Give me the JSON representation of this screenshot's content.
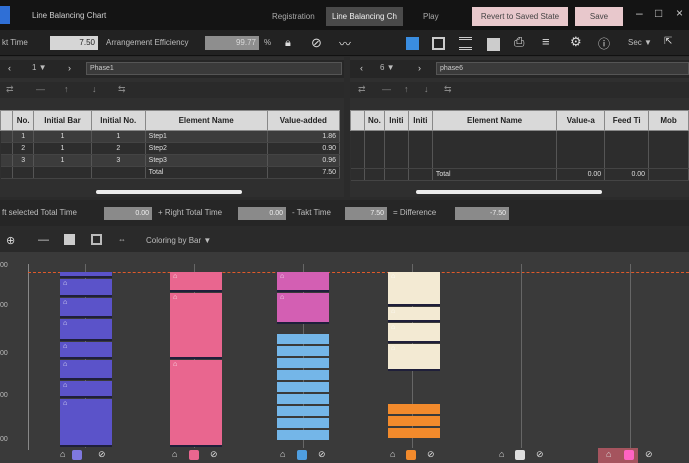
{
  "titlebar": {
    "title": "Line Balancing Chart",
    "tabs": [
      "Registration",
      "Line Balancing Ch",
      "Play"
    ],
    "revert_label": "Revert to Saved State",
    "save_label": "Save"
  },
  "toolbar": {
    "takt_label": "kt Time",
    "takt_value": "7.50",
    "arrangement_label": "Arrangement Efficiency",
    "arrangement_value": "99.77",
    "percent": "%",
    "unit_value": "Sec"
  },
  "left_pane": {
    "page": "1",
    "phase": "Phase1",
    "columns": [
      "No.",
      "Initial Bar",
      "Initial No.",
      "Element Name",
      "Value-added"
    ],
    "rows": [
      {
        "no": "1",
        "bar": "1",
        "ino": "1",
        "name": "Step1",
        "value": "1.86"
      },
      {
        "no": "2",
        "bar": "1",
        "ino": "2",
        "name": "Step2",
        "value": "0.90"
      },
      {
        "no": "3",
        "bar": "1",
        "ino": "3",
        "name": "Step3",
        "value": "0.96"
      }
    ],
    "total_label": "Total",
    "total_value": "7.50"
  },
  "right_pane": {
    "page": "6",
    "phase": "phase6",
    "columns": [
      "No.",
      "Initi",
      "Initi",
      "Element Name",
      "Value-a",
      "Feed Ti",
      "Mob"
    ],
    "total_label": "Total",
    "total_values": [
      "0.00",
      "0.00"
    ]
  },
  "sumbar": {
    "left_label": "ft selected Total Time",
    "left_value": "0.00",
    "right_label": "+ Right Total Time",
    "right_value": "0.00",
    "takt_label": "- Takt Time",
    "takt_value": "7.50",
    "diff_label": "= Difference",
    "diff_value": "-7.50"
  },
  "chart_toolbar": {
    "coloring_label": "Coloring by Bar"
  },
  "chart": {
    "ylabels": [
      "00",
      "00",
      "00",
      "00",
      "00"
    ],
    "bars": [
      {
        "name": "bar-1",
        "color": "#5b53c9",
        "segments": [
          0.04,
          0.11,
          0.12,
          0.13,
          0.1,
          0.12,
          0.1,
          0.28
        ]
      },
      {
        "name": "bar-2",
        "color": "#e9668f",
        "segments": [
          0.12,
          0.38,
          0.5
        ]
      },
      {
        "name": "bar-3",
        "color": "#d35fb3",
        "segments": [
          0.12,
          0.18
        ]
      },
      {
        "name": "bar-4",
        "color": "#f3ead3",
        "segments": [
          0.2,
          0.09,
          0.12,
          0.16
        ]
      }
    ]
  }
}
